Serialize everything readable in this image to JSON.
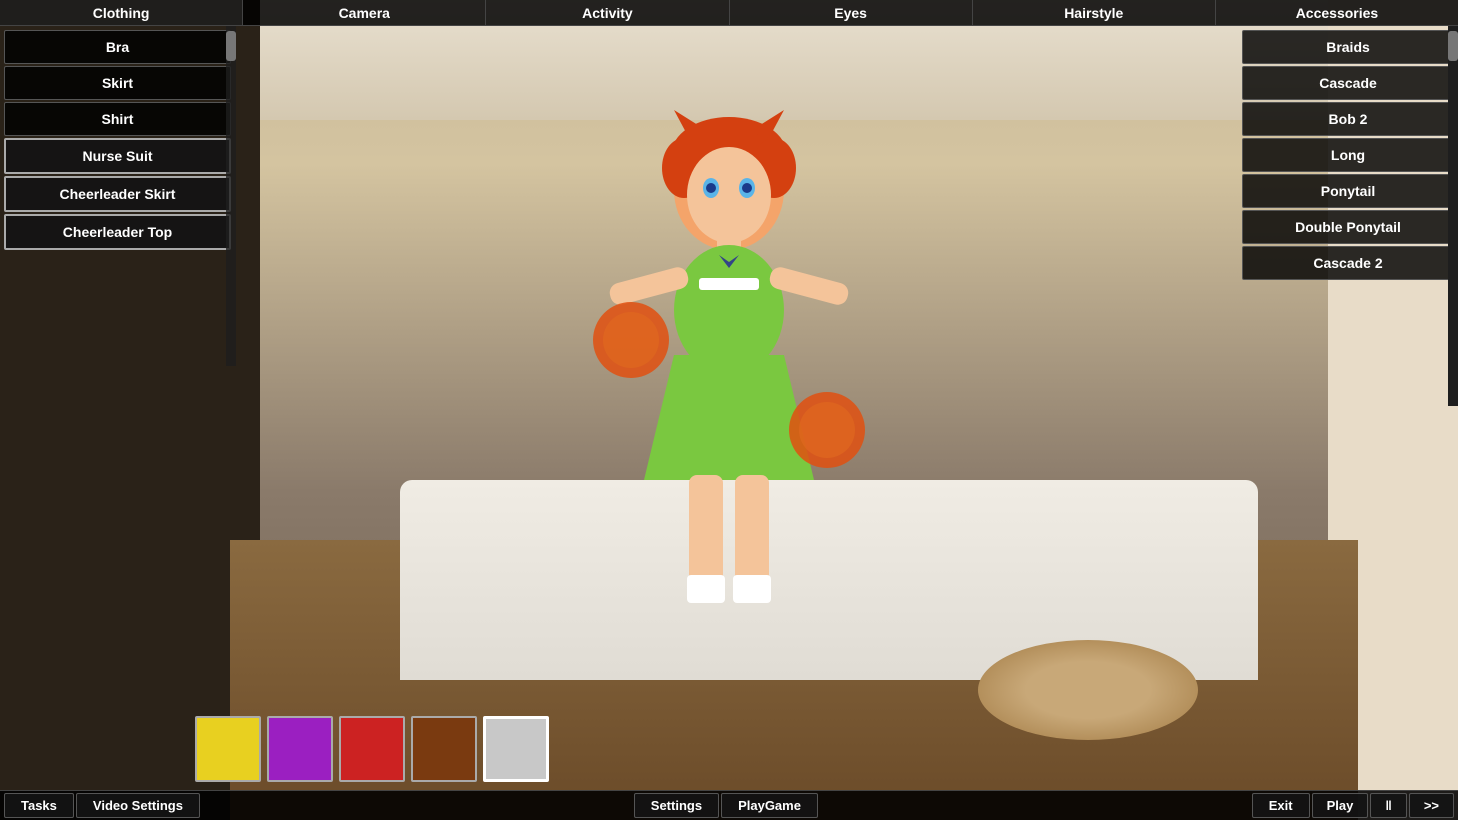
{
  "topBar": {
    "items": [
      {
        "id": "clothing",
        "label": "Clothing"
      },
      {
        "id": "camera",
        "label": "Camera"
      },
      {
        "id": "activity",
        "label": "Activity"
      },
      {
        "id": "eyes",
        "label": "Eyes"
      },
      {
        "id": "hairstyle",
        "label": "Hairstyle"
      },
      {
        "id": "accessories",
        "label": "Accessories"
      }
    ]
  },
  "clothing": {
    "items": [
      {
        "id": "bra",
        "label": "Bra"
      },
      {
        "id": "skirt",
        "label": "Skirt"
      },
      {
        "id": "shirt",
        "label": "Shirt"
      },
      {
        "id": "nurse-suit",
        "label": "Nurse Suit",
        "active": true
      },
      {
        "id": "cheerleader-skirt",
        "label": "Cheerleader Skirt",
        "active": true
      },
      {
        "id": "cheerleader-top",
        "label": "Cheerleader Top",
        "active": true
      }
    ]
  },
  "hairstyle": {
    "items": [
      {
        "id": "braids",
        "label": "Braids"
      },
      {
        "id": "cascade",
        "label": "Cascade"
      },
      {
        "id": "bob2",
        "label": "Bob 2"
      },
      {
        "id": "long",
        "label": "Long"
      },
      {
        "id": "ponytail",
        "label": "Ponytail"
      },
      {
        "id": "double-ponytail",
        "label": "Double Ponytail"
      },
      {
        "id": "cascade2",
        "label": "Cascade 2"
      }
    ]
  },
  "colorSwatches": {
    "colors": [
      {
        "id": "yellow",
        "hex": "#e8d020",
        "active": false
      },
      {
        "id": "purple",
        "hex": "#9b1fc1",
        "active": false
      },
      {
        "id": "red",
        "hex": "#cc2222",
        "active": false
      },
      {
        "id": "brown",
        "hex": "#7a3a10",
        "active": false
      },
      {
        "id": "lightgray",
        "hex": "#c8c8c8",
        "active": true
      }
    ]
  },
  "bottomBar": {
    "tasks": "Tasks",
    "videoSettings": "Video Settings",
    "settings": "Settings",
    "playGame": "PlayGame",
    "exit": "Exit",
    "play": "Play",
    "pause": "‖",
    "forward": ">>"
  }
}
